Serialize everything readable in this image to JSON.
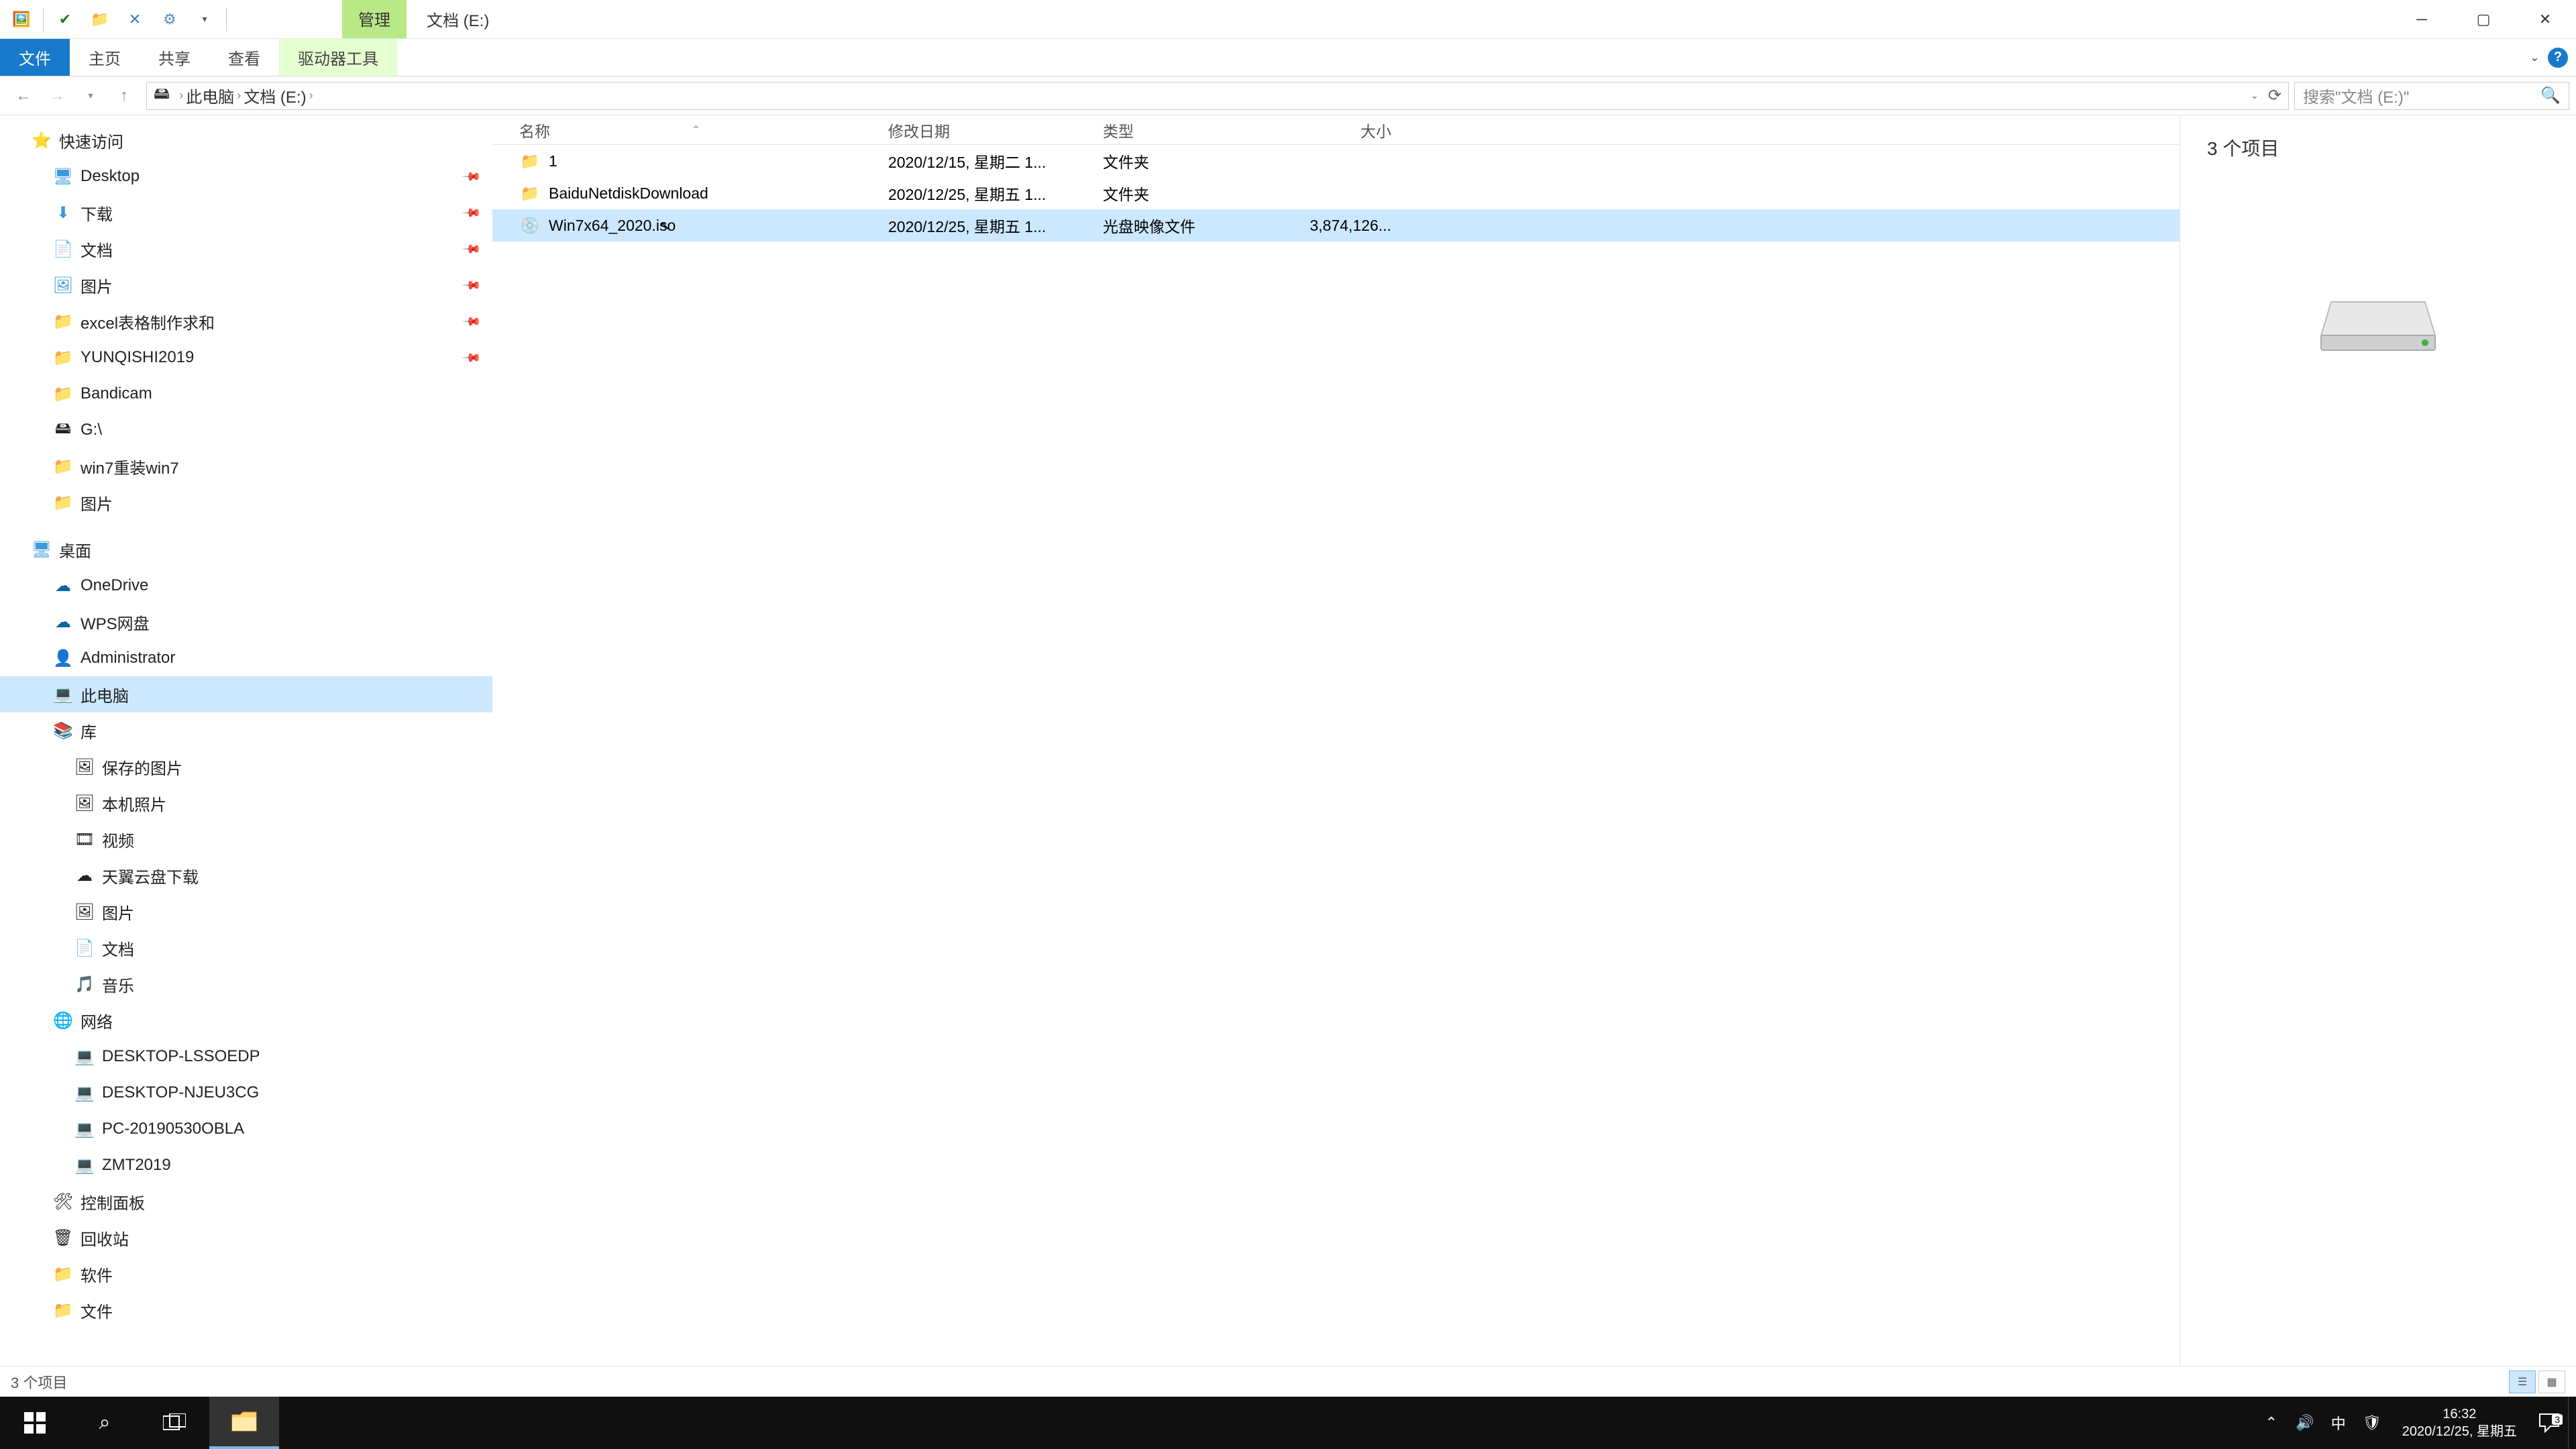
{
  "title": {
    "contextual_tab": "管理",
    "window_title": "文档 (E:)"
  },
  "ribbon": {
    "file": "文件",
    "home": "主页",
    "share": "共享",
    "view": "查看",
    "drive_tools": "驱动器工具"
  },
  "breadcrumb": {
    "this_pc": "此电脑",
    "current": "文档 (E:)"
  },
  "search": {
    "placeholder": "搜索\"文档 (E:)\""
  },
  "sidebar": {
    "quick_access": "快速访问",
    "items_qa": [
      "Desktop",
      "下载",
      "文档",
      "图片",
      "excel表格制作求和",
      "YUNQISHI2019",
      "Bandicam",
      "G:\\",
      "win7重装win7",
      "图片"
    ],
    "desktop": "桌面",
    "onedrive": "OneDrive",
    "wps": "WPS网盘",
    "admin": "Administrator",
    "this_pc": "此电脑",
    "libraries": "库",
    "lib_items": [
      "保存的图片",
      "本机照片",
      "视频",
      "天翼云盘下载",
      "图片",
      "文档",
      "音乐"
    ],
    "network": "网络",
    "net_items": [
      "DESKTOP-LSSOEDP",
      "DESKTOP-NJEU3CG",
      "PC-20190530OBLA",
      "ZMT2019"
    ],
    "control_panel": "控制面板",
    "recycle": "回收站",
    "soft": "软件",
    "fileroot": "文件"
  },
  "columns": {
    "name": "名称",
    "date": "修改日期",
    "type": "类型",
    "size": "大小"
  },
  "files": [
    {
      "name": "1",
      "date": "2020/12/15, 星期二 1...",
      "type": "文件夹",
      "size": "",
      "kind": "folder"
    },
    {
      "name": "BaiduNetdiskDownload",
      "date": "2020/12/25, 星期五 1...",
      "type": "文件夹",
      "size": "",
      "kind": "folder"
    },
    {
      "name": "Win7x64_2020.iso",
      "date": "2020/12/25, 星期五 1...",
      "type": "光盘映像文件",
      "size": "3,874,126...",
      "kind": "iso",
      "selected": true
    }
  ],
  "preview": {
    "item_count": "3 个项目"
  },
  "statusbar": {
    "text": "3 个项目"
  },
  "taskbar": {
    "time": "16:32",
    "date": "2020/12/25, 星期五",
    "ime": "中",
    "notif_count": "3"
  }
}
